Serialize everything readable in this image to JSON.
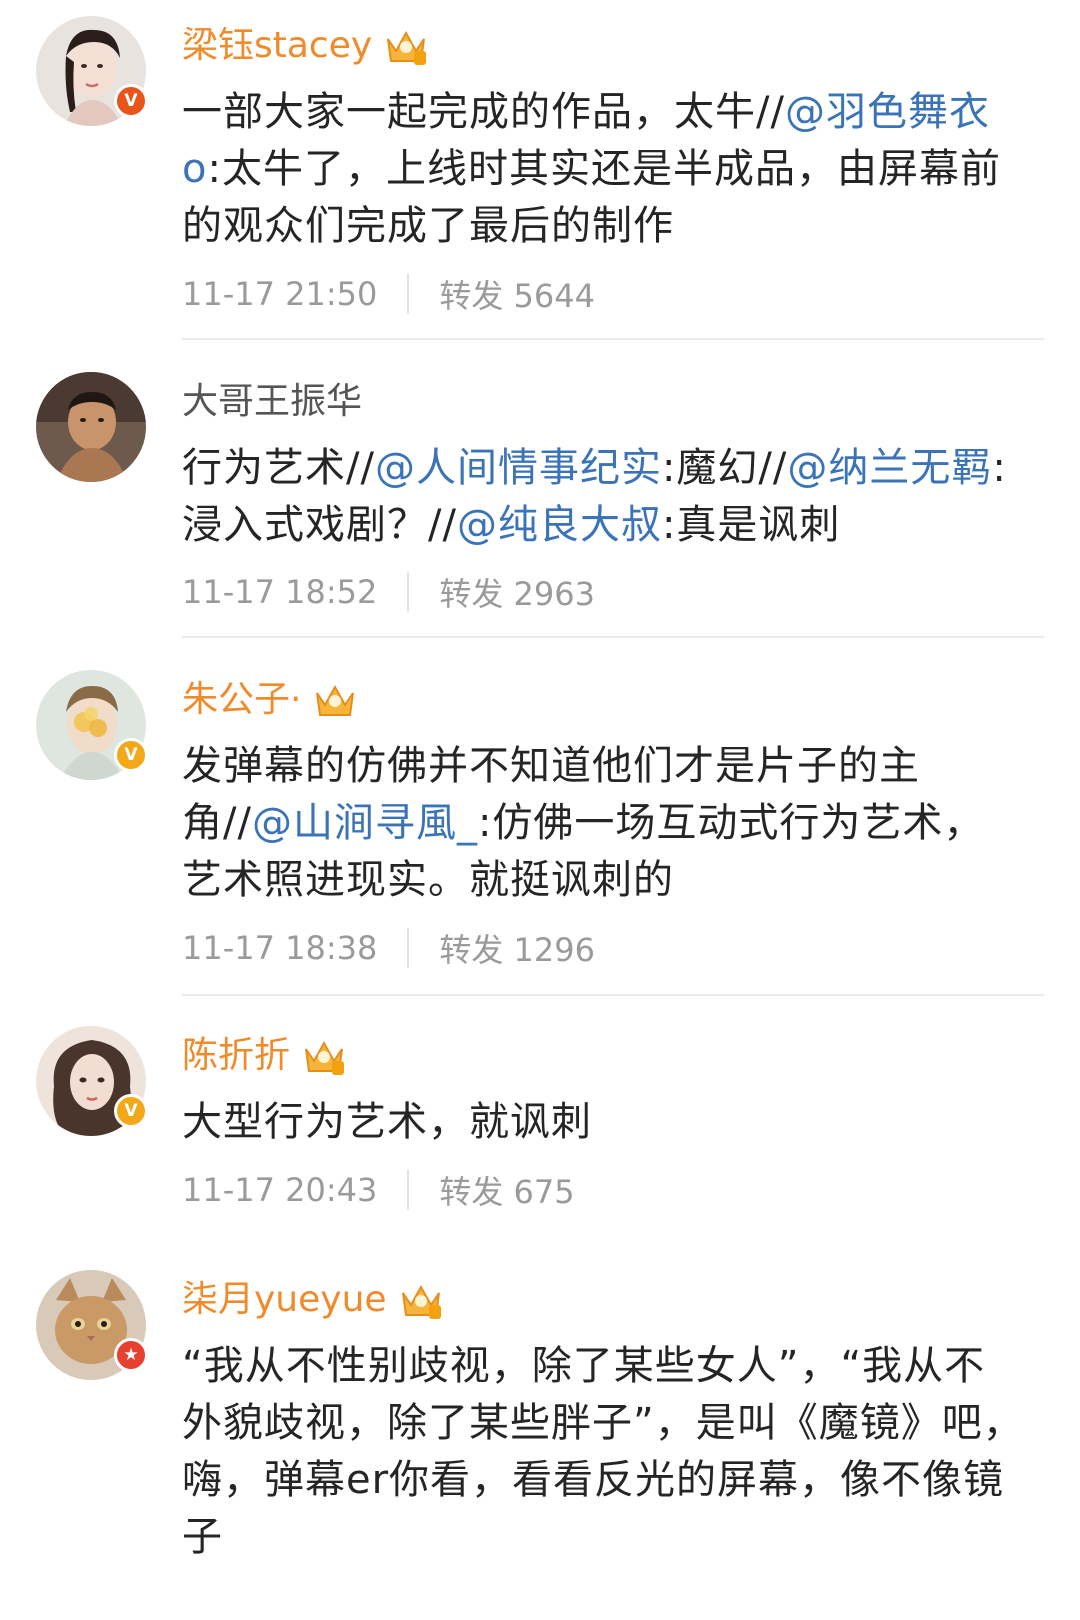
{
  "comments": [
    {
      "username": "梁钰stacey",
      "badge": "V",
      "badge_color": "#e8541a",
      "text": [
        "一部大家一起完成的作品，太牛//",
        "@羽色舞衣o",
        ":太牛了，上线时其实还是半成品，由屏幕前的观众们完成了最后的制作"
      ],
      "time": "11-17 21:50",
      "reposts": "转发 5644"
    },
    {
      "username": "大哥王振华",
      "text": [
        "行为艺术//",
        "@人间情事纪实",
        ":魔幻//",
        "@纳兰无羁",
        ":浸入式戏剧？//",
        "@纯良大叔",
        ":真是讽刺"
      ],
      "time": "11-17 18:52",
      "reposts": "转发 2963"
    },
    {
      "username": "朱公子·",
      "badge": "V",
      "badge_color": "#f2a817",
      "text": [
        "发弹幕的仿佛并不知道他们才是片子的主角//",
        "@山涧寻風_",
        ":仿佛一场互动式行为艺术，艺术照进现实。就挺讽刺的"
      ],
      "time": "11-17 18:38",
      "reposts": "转发 1296"
    },
    {
      "username": "陈折折",
      "badge": "V",
      "badge_color": "#f2a817",
      "text": [
        "大型行为艺术，就讽刺"
      ],
      "time": "11-17 20:43",
      "reposts": "转发 675"
    },
    {
      "username": "柒月yueyue",
      "badge": "★",
      "badge_color": "#e8402f",
      "text": [
        "“我从不性别歧视，除了某些女人”，“我从不外貌歧视，除了某些胖子”，是叫《魔镜》吧，嗨，弹幕er你看，看看反光的屏幕，像不像镜子"
      ]
    }
  ]
}
